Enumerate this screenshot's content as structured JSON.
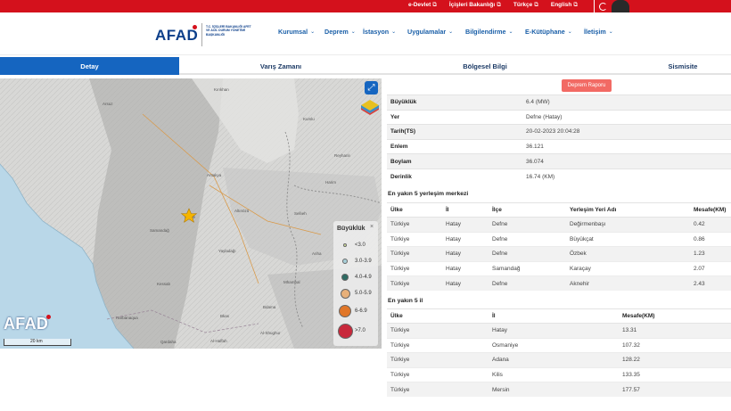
{
  "topbar": {
    "links": [
      "e-Devlet",
      "İçişleri Bakanlığı",
      "Türkçe",
      "English"
    ],
    "colors": {
      "bar": "#d4111c"
    }
  },
  "header": {
    "logo": "AFAD",
    "logo_subtitle": "T.C. İÇİŞLERİ BAKANLIĞI AFET VE ACİL DURUM YÖNETİMİ BAŞKANLIĞI",
    "nav": [
      "Kurumsal",
      "Deprem",
      "İstasyon",
      "Uygulamalar",
      "Bilgilendirme",
      "E-Kütüphane",
      "İletişim"
    ]
  },
  "tabs": [
    {
      "label": "Detay",
      "active": true
    },
    {
      "label": "Varış Zamanı",
      "active": false
    },
    {
      "label": "Bölgesel Bilgi",
      "active": false
    },
    {
      "label": "Sismisite",
      "active": false
    }
  ],
  "map": {
    "labels": [
      "Arsuz",
      "Kırıkhan",
      "Kumlu",
      "Reyhanlı",
      "Antakya",
      "Defne",
      "Samandağ",
      "Altınözü",
      "Yayladağı",
      "Sellıeh",
      "Harim",
      "Ariha",
      "Mhambal",
      "Bdama",
      "Bkas",
      "Al-Shughur",
      "Al-Haffah",
      "Qardaha",
      "Harbanaqua",
      "Kessab"
    ],
    "legend": {
      "title": "Büyüklük",
      "close": "×",
      "items": [
        {
          "label": "<3.0",
          "color": "#d8e8a0"
        },
        {
          "label": "3.0-3.9",
          "color": "#a8cfd8"
        },
        {
          "label": "4.0-4.9",
          "color": "#2e6b63"
        },
        {
          "label": "5.0-5.9",
          "color": "#e7b07a"
        },
        {
          "label": "6-6.9",
          "color": "#e07628"
        },
        {
          "label": ">7.0",
          "color": "#c8283b"
        }
      ]
    },
    "logo": "AFAD",
    "scale": "20 km",
    "expand_icon": "⤢"
  },
  "report_button": "Deprem Raporu",
  "details": [
    {
      "key": "Büyüklük",
      "value": "6.4 (MW)"
    },
    {
      "key": "Yer",
      "value": "Defne (Hatay)"
    },
    {
      "key": "Tarih(TS)",
      "value": "20-02-2023 20:04:28"
    },
    {
      "key": "Enlem",
      "value": "36.121"
    },
    {
      "key": "Boylam",
      "value": "36.074"
    },
    {
      "key": "Derinlik",
      "value": "16.74 (KM)"
    }
  ],
  "settlements": {
    "title": "En yakın 5 yerleşim merkezi",
    "headers": [
      "Ülke",
      "İl",
      "İlçe",
      "Yerleşim Yeri Adı",
      "Mesafe(KM)"
    ],
    "rows": [
      [
        "Türkiye",
        "Hatay",
        "Defne",
        "Değirmenbaşı",
        "0.42"
      ],
      [
        "Türkiye",
        "Hatay",
        "Defne",
        "Büyükçat",
        "0.86"
      ],
      [
        "Türkiye",
        "Hatay",
        "Defne",
        "Özbek",
        "1.23"
      ],
      [
        "Türkiye",
        "Hatay",
        "Samandağ",
        "Karaçay",
        "2.07"
      ],
      [
        "Türkiye",
        "Hatay",
        "Defne",
        "Aknehir",
        "2.43"
      ]
    ]
  },
  "provinces": {
    "title": "En yakın 5 il",
    "headers": [
      "Ülke",
      "İl",
      "Mesafe(KM)"
    ],
    "rows": [
      [
        "Türkiye",
        "Hatay",
        "13.31"
      ],
      [
        "Türkiye",
        "Osmaniye",
        "107.32"
      ],
      [
        "Türkiye",
        "Adana",
        "128.22"
      ],
      [
        "Türkiye",
        "Kilis",
        "133.35"
      ],
      [
        "Türkiye",
        "Mersin",
        "177.57"
      ]
    ]
  },
  "colors": {
    "primary": "#1565c0",
    "brand": "#0d3f8a",
    "alert": "#f26a64",
    "epicenter": "#f4b400"
  }
}
